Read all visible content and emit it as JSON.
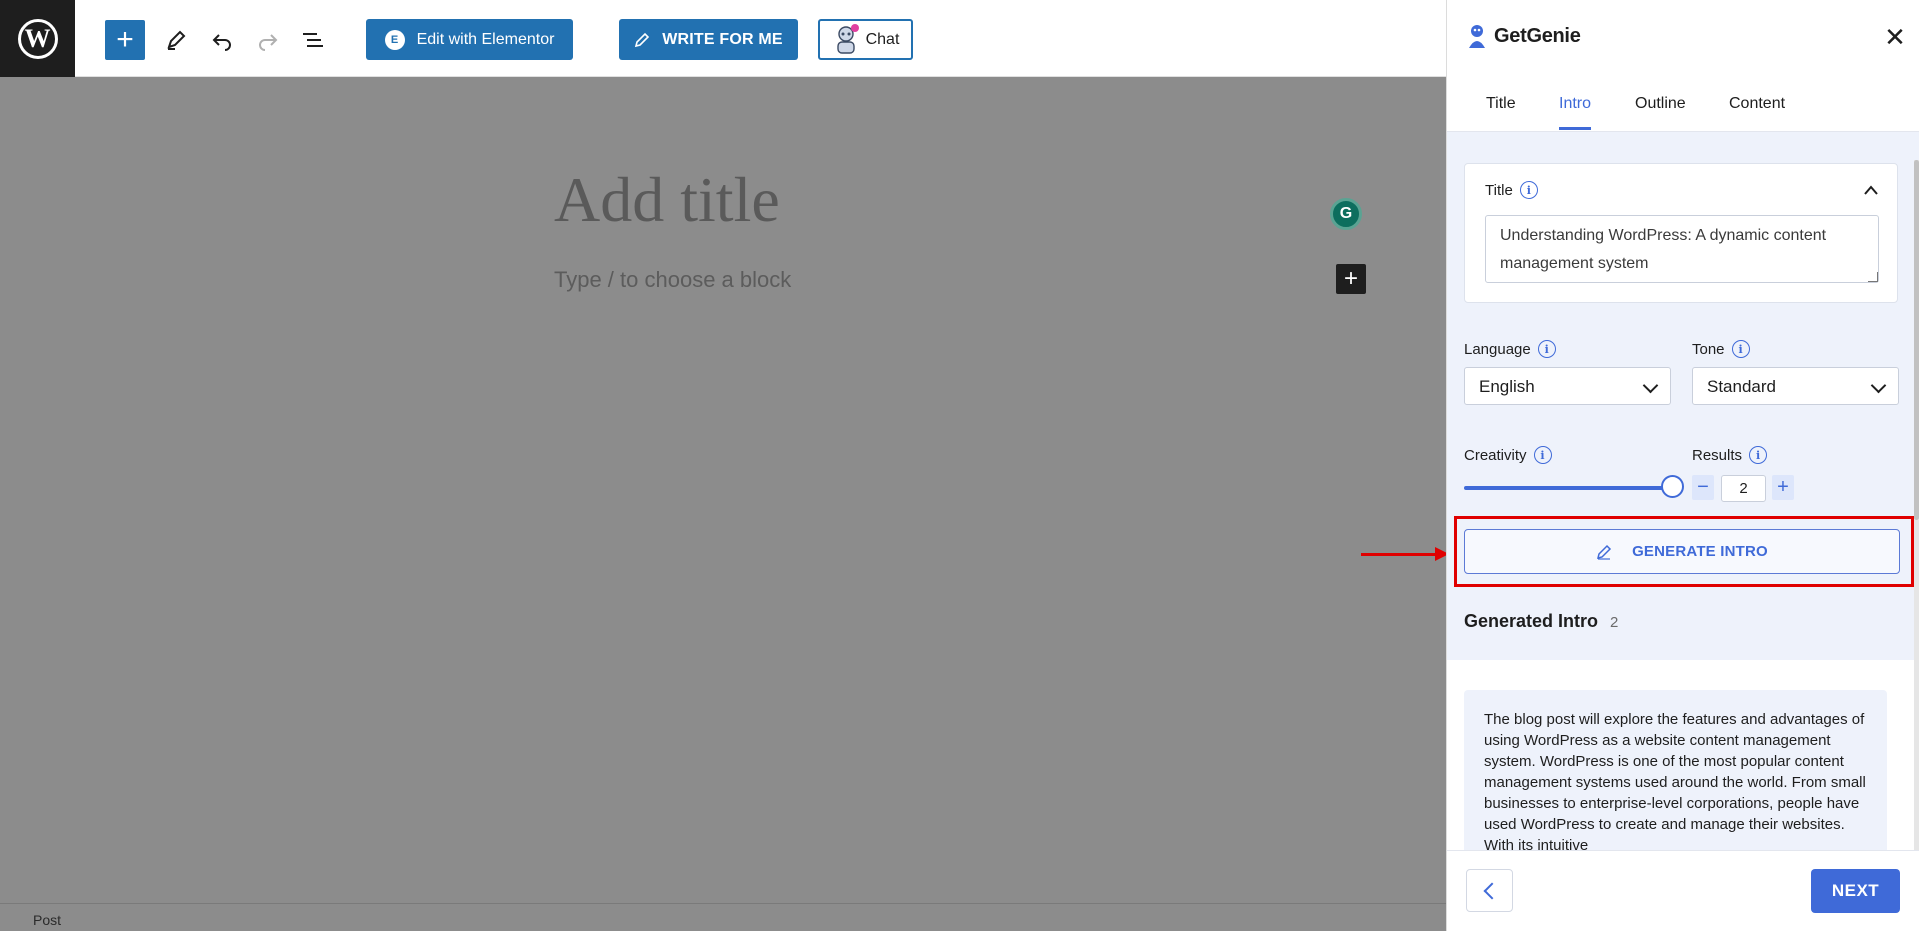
{
  "toolbar": {
    "elementor_label": "Edit with Elementor",
    "write_label": "WRITE FOR ME",
    "chat_label": "Chat"
  },
  "editor": {
    "title_placeholder": "Add title",
    "block_hint": "Type / to choose a block",
    "status_label": "Post"
  },
  "panel": {
    "brand": "GetGenie",
    "tabs": [
      "Title",
      "Intro",
      "Outline",
      "Content"
    ],
    "active_tab": "Intro",
    "title_label": "Title",
    "title_value": "Understanding WordPress: A dynamic content management system",
    "language_label": "Language",
    "language_value": "English",
    "tone_label": "Tone",
    "tone_value": "Standard",
    "creativity_label": "Creativity",
    "creativity_level": 1.0,
    "results_label": "Results",
    "results_value": "2",
    "generate_label": "GENERATE INTRO",
    "generated_heading": "Generated Intro",
    "generated_count": "2",
    "intro_text": "The blog post will explore the features and advantages of using WordPress as a website content management system. WordPress is one of the most popular content management systems used around the world. From small businesses to enterprise-level corporations, people have used WordPress to create and manage their websites. With its intuitive",
    "next_label": "NEXT"
  },
  "colors": {
    "wp_blue": "#2271b1",
    "genie_blue": "#3f6ad8",
    "annotation_red": "#e00000"
  },
  "icons": [
    "wordpress-logo-icon",
    "plus-icon",
    "pencil-icon",
    "undo-icon",
    "redo-icon",
    "list-view-icon",
    "elementor-icon",
    "robot-icon",
    "grammarly-icon",
    "close-icon",
    "info-icon",
    "chevron-down-icon",
    "chevron-up-icon",
    "minus-icon",
    "chevron-left-icon"
  ]
}
